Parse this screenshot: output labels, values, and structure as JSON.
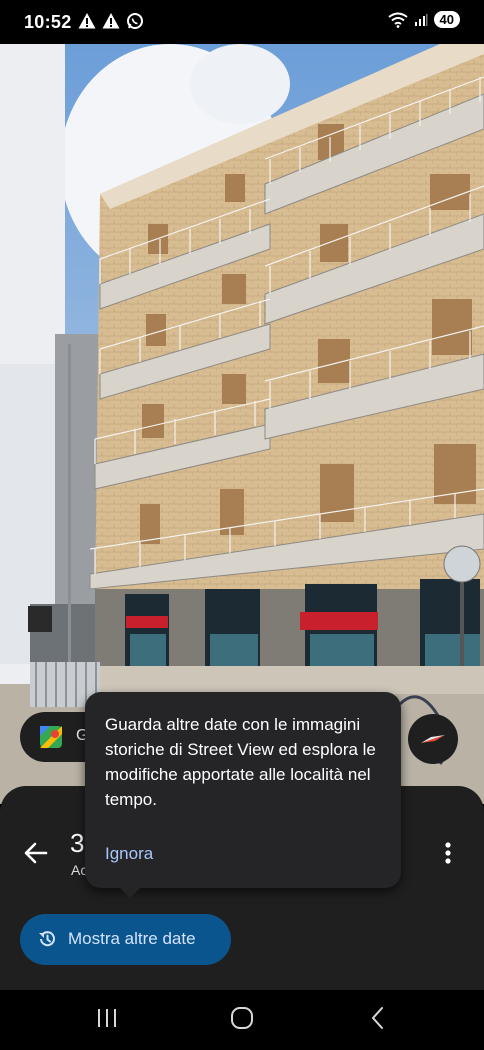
{
  "status_bar": {
    "time": "10:52",
    "battery": "40",
    "left_icons": [
      "warning-icon",
      "warning-icon",
      "whatsapp-icon"
    ],
    "right_icons": [
      "wifi-icon",
      "signal-icon"
    ]
  },
  "place_chip": {
    "label": "G",
    "icon": "google-maps-icon"
  },
  "tooltip": {
    "text": "Guarda altre date con le immagini storiche di Street View ed esplora le modifiche apportate alle località nel tempo.",
    "dismiss_label": "Ignora"
  },
  "bottom_sheet": {
    "title": "3",
    "subtitle": "Ac",
    "show_more_dates_label": "Mostra altre date",
    "show_more_dates_icon": "history-icon",
    "back_icon": "back-arrow-icon",
    "more_icon": "more-vert-icon"
  },
  "nav_bar": {
    "items": [
      "recent-apps-icon",
      "home-icon",
      "back-icon"
    ]
  },
  "colors": {
    "tooltip_bg": "#252528",
    "link_blue": "#a8c7fa",
    "primary_button_bg": "#0b558e",
    "sheet_bg": "#1f1f1f"
  }
}
